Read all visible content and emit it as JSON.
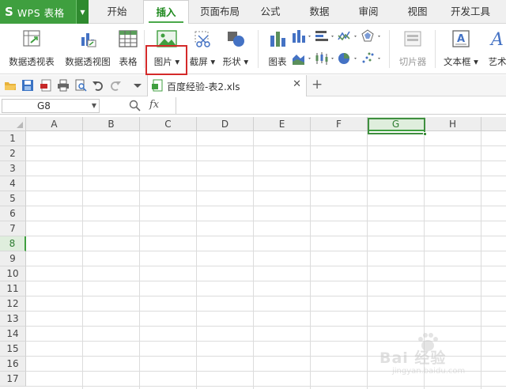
{
  "app": {
    "logo_letter": "S",
    "logo_text": "WPS 表格"
  },
  "menu_tabs": [
    {
      "label": "开始",
      "active": false
    },
    {
      "label": "插入",
      "active": true
    },
    {
      "label": "页面布局",
      "active": false
    },
    {
      "label": "公式",
      "active": false
    },
    {
      "label": "数据",
      "active": false
    },
    {
      "label": "审阅",
      "active": false
    },
    {
      "label": "视图",
      "active": false
    },
    {
      "label": "开发工具",
      "active": false
    }
  ],
  "ribbon": {
    "pivot_table": "数据透视表",
    "pivot_chart": "数据透视图",
    "table": "表格",
    "picture": "图片",
    "screenshot": "截屏",
    "shapes": "形状",
    "chart": "图表",
    "slicer": "切片器",
    "textbox": "文本框",
    "wordart": "艺术"
  },
  "file_tab": {
    "name": "百度经验-表2.xls"
  },
  "formula_bar": {
    "cell_ref": "G8",
    "fx_label": "fx"
  },
  "columns": [
    "A",
    "B",
    "C",
    "D",
    "E",
    "F",
    "G",
    "H"
  ],
  "rows": [
    "1",
    "2",
    "3",
    "4",
    "5",
    "6",
    "7",
    "8",
    "9",
    "10",
    "11",
    "12",
    "13",
    "14",
    "15",
    "16",
    "17"
  ],
  "selected": {
    "column": "G",
    "row": "8"
  },
  "watermark": {
    "text": "Bai 经验",
    "sub": "jingyan.baidu.com"
  },
  "colors": {
    "brand_green": "#3f9f3f",
    "highlight_red": "#d42a2a"
  }
}
